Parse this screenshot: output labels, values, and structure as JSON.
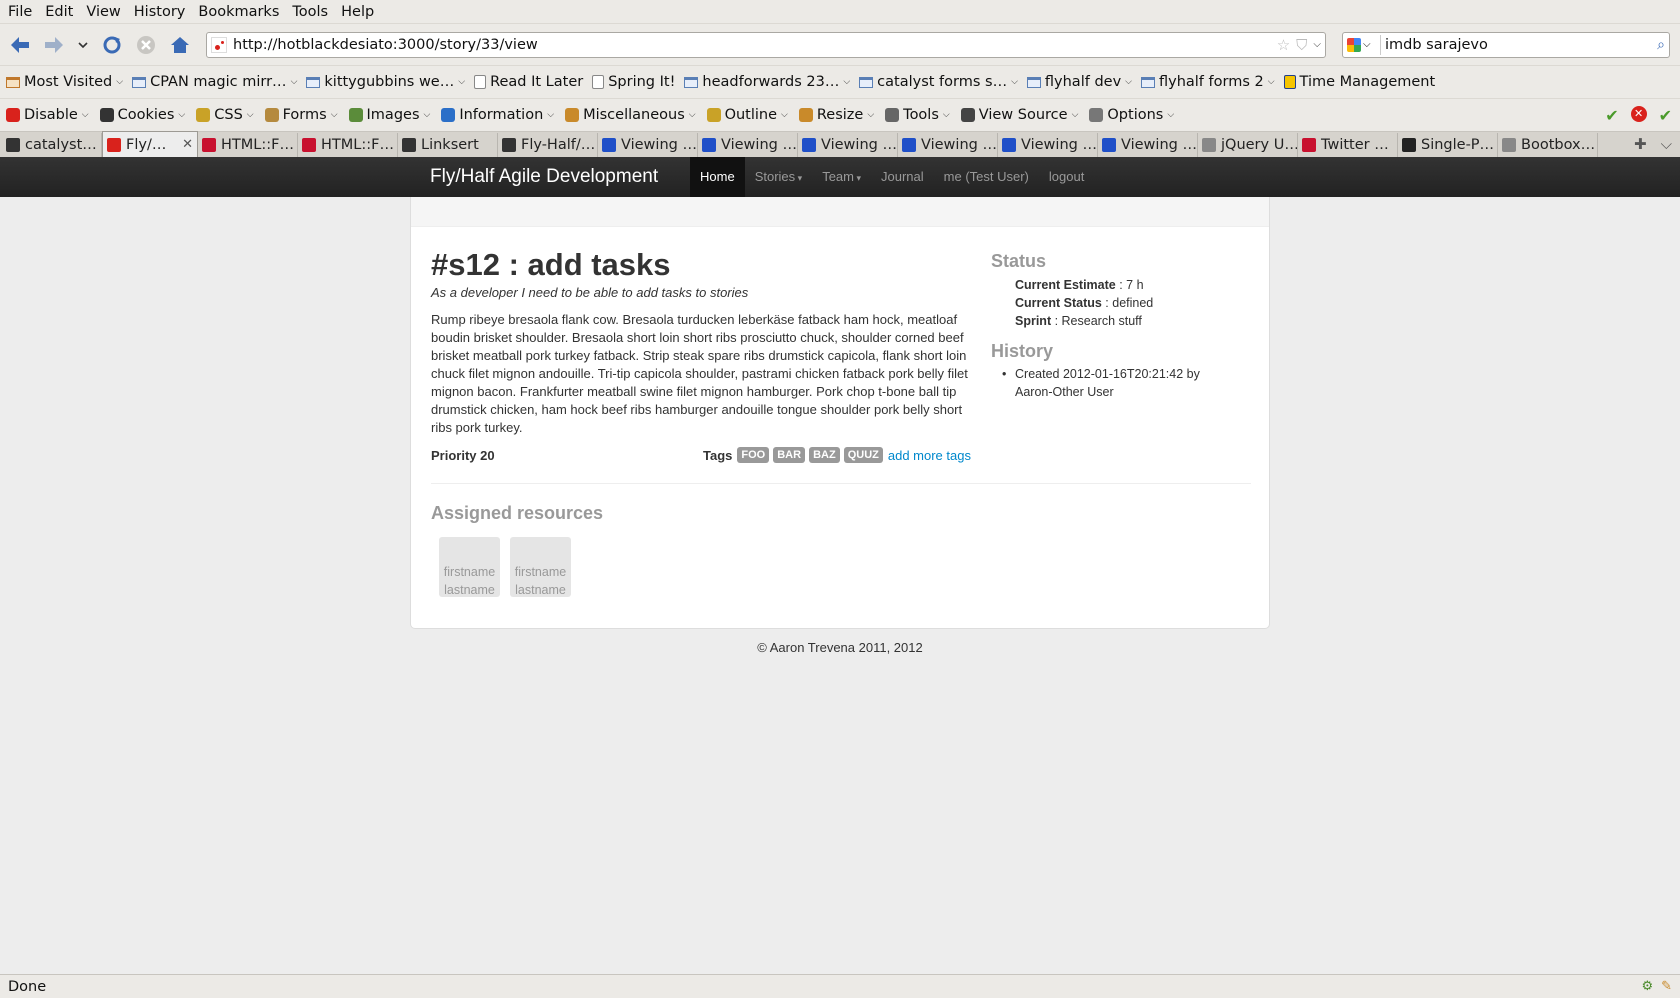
{
  "browser": {
    "menu": [
      "File",
      "Edit",
      "View",
      "History",
      "Bookmarks",
      "Tools",
      "Help"
    ],
    "url": "http://hotblackdesiato:3000/story/33/view",
    "search_value": "imdb sarajevo",
    "bookmarks": [
      {
        "label": "Most Visited",
        "type": "folder-orange",
        "dropdown": true
      },
      {
        "label": "CPAN magic mirr…",
        "type": "folder",
        "dropdown": true
      },
      {
        "label": "kittygubbins we…",
        "type": "folder",
        "dropdown": true
      },
      {
        "label": "Read It Later",
        "type": "page"
      },
      {
        "label": "Spring It!",
        "type": "page"
      },
      {
        "label": "headforwards 23…",
        "type": "folder",
        "dropdown": true
      },
      {
        "label": "catalyst forms s…",
        "type": "folder",
        "dropdown": true
      },
      {
        "label": "flyhalf dev",
        "type": "folder",
        "dropdown": true
      },
      {
        "label": "flyhalf forms 2",
        "type": "folder",
        "dropdown": true
      },
      {
        "label": "Time Management",
        "type": "page-yellow"
      }
    ],
    "devtools": [
      {
        "label": "Disable",
        "color": "#d9221c"
      },
      {
        "label": "Cookies",
        "color": "#333333"
      },
      {
        "label": "CSS",
        "color": "#c9a227"
      },
      {
        "label": "Forms",
        "color": "#b58a3e"
      },
      {
        "label": "Images",
        "color": "#5b8c3a"
      },
      {
        "label": "Information",
        "color": "#2b6fc8"
      },
      {
        "label": "Miscellaneous",
        "color": "#c98a2a"
      },
      {
        "label": "Outline",
        "color": "#c9a227"
      },
      {
        "label": "Resize",
        "color": "#c98a2a"
      },
      {
        "label": "Tools",
        "color": "#666666"
      },
      {
        "label": "View Source",
        "color": "#444444"
      },
      {
        "label": "Options",
        "color": "#777777"
      }
    ],
    "tabs": [
      {
        "label": "catalyst…",
        "color": "#333333",
        "active": false
      },
      {
        "label": "Fly/…",
        "color": "#d9221c",
        "active": true
      },
      {
        "label": "HTML::F…",
        "color": "#c8102e",
        "active": false
      },
      {
        "label": "HTML::F…",
        "color": "#c8102e",
        "active": false
      },
      {
        "label": "Linksert",
        "color": "#333333",
        "active": false
      },
      {
        "label": "Fly-Half/…",
        "color": "#333333",
        "active": false
      },
      {
        "label": "Viewing …",
        "color": "#1f4fc8",
        "active": false
      },
      {
        "label": "Viewing …",
        "color": "#1f4fc8",
        "active": false
      },
      {
        "label": "Viewing …",
        "color": "#1f4fc8",
        "active": false
      },
      {
        "label": "Viewing …",
        "color": "#1f4fc8",
        "active": false
      },
      {
        "label": "Viewing …",
        "color": "#1f4fc8",
        "active": false
      },
      {
        "label": "Viewing …",
        "color": "#1f4fc8",
        "active": false
      },
      {
        "label": "jQuery U…",
        "color": "#888888",
        "active": false
      },
      {
        "label": "Twitter …",
        "color": "#c8102e",
        "active": false
      },
      {
        "label": "Single-P…",
        "color": "#222222",
        "active": false
      },
      {
        "label": "Bootbox…",
        "color": "#888888",
        "active": false
      }
    ],
    "status_text": "Done"
  },
  "site": {
    "brand": "Fly/Half Agile Development",
    "nav": [
      {
        "label": "Home",
        "active": true,
        "dropdown": false
      },
      {
        "label": "Stories",
        "active": false,
        "dropdown": true
      },
      {
        "label": "Team",
        "active": false,
        "dropdown": true
      },
      {
        "label": "Journal",
        "active": false,
        "dropdown": false
      },
      {
        "label": "me (Test User)",
        "active": false,
        "dropdown": false
      },
      {
        "label": "logout",
        "active": false,
        "dropdown": false
      }
    ]
  },
  "story": {
    "title": "#s12 : add tasks",
    "subtitle": "As a developer I need to be able to add tasks to stories",
    "body": "Rump ribeye bresaola flank cow. Bresaola turducken leberkäse fatback ham hock, meatloaf boudin brisket shoulder. Bresaola short loin short ribs prosciutto chuck, shoulder corned beef brisket meatball pork turkey fatback. Strip steak spare ribs drumstick capicola, flank short loin chuck filet mignon andouille. Tri-tip capicola shoulder, pastrami chicken fatback pork belly filet mignon bacon. Frankfurter meatball swine filet mignon hamburger. Pork chop t-bone ball tip drumstick chicken, ham hock beef ribs hamburger andouille tongue shoulder pork belly short ribs pork turkey.",
    "priority": "Priority 20",
    "tags_label": "Tags",
    "tags": [
      "FOO",
      "BAR",
      "BAZ",
      "QUUZ"
    ],
    "add_tags": "add more tags",
    "status_heading": "Status",
    "status": [
      {
        "key": "Current Estimate",
        "value": " : 7 h"
      },
      {
        "key": "Current Status",
        "value": " : defined"
      },
      {
        "key": "Sprint",
        "value": " : Research stuff"
      }
    ],
    "history_heading": "History",
    "history": [
      "Created 2012-01-16T20:21:42 by Aaron-Other User"
    ],
    "assigned_heading": "Assigned resources",
    "resources": [
      {
        "firstname": "firstname",
        "lastname": "lastname"
      },
      {
        "firstname": "firstname",
        "lastname": "lastname"
      }
    ]
  },
  "footer": "© Aaron Trevena 2011, 2012"
}
